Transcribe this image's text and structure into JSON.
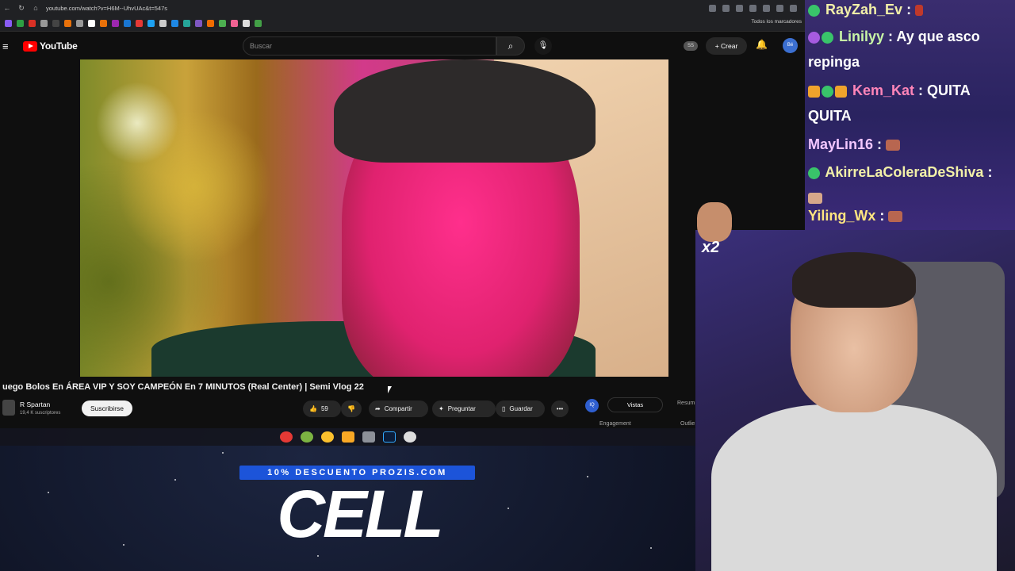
{
  "browser": {
    "url": "youtube.com/watch?v=H6M--UhvUAc&t=547s",
    "bookmarks_label": "Todos los marcadores"
  },
  "youtube": {
    "logo": "YouTube",
    "search_placeholder": "Buscar",
    "ss_badge": "SS",
    "create_label": "Crear",
    "avatar_label": "Bé"
  },
  "video": {
    "title": "uego Bolos En ÁREA VIP Y SOY CAMPEÓN En 7 MINUTOS (Real Center) | Semi Vlog 22",
    "channel": "R Spartan",
    "subscribers": "19,4 K suscriptores",
    "subscribe_label": "Suscribirse",
    "likes": "59",
    "share_label": "Compartir",
    "ask_label": "Preguntar",
    "save_label": "Guardar"
  },
  "side_panel": {
    "ai_label": "IQ",
    "tab_active": "Vistas",
    "tab_other": "Resum",
    "engagement": "Engagement",
    "outline": "Outlie"
  },
  "promo": {
    "banner": "10% DESCUENTO PROZIS.COM",
    "brand": "CELL"
  },
  "chat": {
    "messages": [
      {
        "user": "RayZah_Ev",
        "text": ""
      },
      {
        "user": "Linilyy",
        "text": "Ay que asco repinga"
      },
      {
        "user": "Kem_Kat",
        "text": "QUITA QUITA"
      },
      {
        "user": "MayLin16",
        "text": ""
      },
      {
        "user": "AkirreLaColeraDeShiva",
        "text": ""
      },
      {
        "user": "Yiling_Wx",
        "text": ""
      }
    ]
  },
  "overlay": {
    "multiplier": "x2"
  }
}
